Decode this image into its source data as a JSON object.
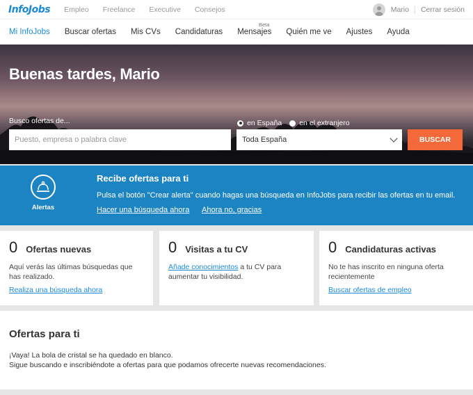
{
  "top_bar": {
    "logo": "InfoJobs",
    "links": [
      "Empleo",
      "Freelance",
      "Executive",
      "Consejos"
    ],
    "user_name": "Mario",
    "logout": "Cerrar sesión"
  },
  "main_nav": {
    "items": [
      {
        "label": "Mi InfoJobs",
        "active": true
      },
      {
        "label": "Buscar ofertas"
      },
      {
        "label": "Mis CVs"
      },
      {
        "label": "Candidaturas"
      },
      {
        "label": "Mensajes",
        "badge": "Beta"
      },
      {
        "label": "Quién me ve"
      },
      {
        "label": "Ajustes"
      },
      {
        "label": "Ayuda"
      }
    ]
  },
  "hero": {
    "greeting": "Buenas tardes, Mario",
    "search_label": "Busco ofertas de...",
    "radio_spain": "en España",
    "radio_abroad": "en el extranjero",
    "radio_selected": "en España",
    "keyword_placeholder": "Puesto, empresa o palabra clave",
    "location_value": "Toda España",
    "search_button": "BUSCAR"
  },
  "alert_banner": {
    "icon_label": "Alertas",
    "title": "Recibe ofertas para ti",
    "description": "Pulsa el botón \"Crear alerta\" cuando hagas una búsqueda en InfoJobs para recibir las ofertas en tu email.",
    "link_search": "Hacer una búsqueda ahora",
    "link_dismiss": "Ahora no, gracias"
  },
  "cards": [
    {
      "count": "0",
      "title": "Ofertas nuevas",
      "text": "Aquí verás las últimas búsquedas que has realizado.",
      "link": "Realiza una búsqueda ahora"
    },
    {
      "count": "0",
      "title": "Visitas a tu CV",
      "text_link": "Añade conocimientos",
      "text_rest": " a tu CV para aumentar tu visibilidad.",
      "link": ""
    },
    {
      "count": "0",
      "title": "Candidaturas activas",
      "text": "No te has inscrito en ninguna oferta recientemente",
      "link": "Buscar ofertas de empleo"
    }
  ],
  "offers": {
    "title": "Ofertas para ti",
    "line1": "¡Vaya! La bola de cristal se ha quedado en blanco.",
    "line2": "Sigue buscando e inscribiéndote a ofertas para que podamos ofrecerte nuevas recomendaciones."
  },
  "colors": {
    "brand_blue": "#1c8ad6",
    "banner_blue": "#1d84c4",
    "search_orange": "#f3693a"
  },
  "icons": {
    "alert": "service-bell-icon",
    "avatar": "user-avatar-icon",
    "dropdown": "chevron-down-icon"
  }
}
